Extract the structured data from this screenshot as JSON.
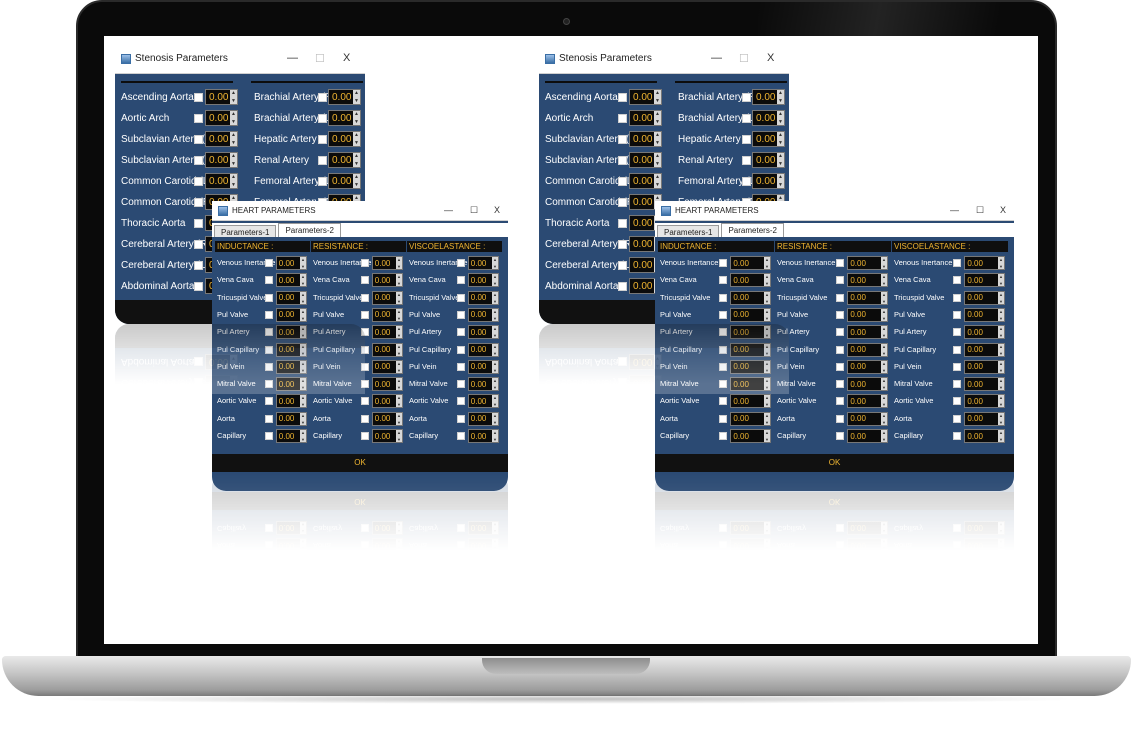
{
  "stenosis_window": {
    "title": "Stenosis Parameters",
    "minimize_glyph": "—",
    "maximize_glyph": "☐",
    "close_glyph": "X",
    "left_items": [
      {
        "label": "Ascending Aorta",
        "value": "0.00"
      },
      {
        "label": "Aortic Arch",
        "value": "0.00"
      },
      {
        "label": "Subclavian Artery (L)",
        "value": "0.00"
      },
      {
        "label": "Subclavian Artery (R)",
        "value": "0.00"
      },
      {
        "label": "Common Carotid (L)",
        "value": "0.00"
      },
      {
        "label": "Common Carotid (R)",
        "value": "0.00"
      },
      {
        "label": "Thoracic Aorta",
        "value": "0.00"
      },
      {
        "label": "Cereberal Artery (R)",
        "value": "0.00"
      },
      {
        "label": "Cereberal Artery (L)",
        "value": "0.00"
      },
      {
        "label": "Abdominal Aorta",
        "value": "0.00"
      }
    ],
    "right_items": [
      {
        "label": "Brachial Artery (R)",
        "value": "0.00"
      },
      {
        "label": "Brachial Artery (L)",
        "value": "0.00"
      },
      {
        "label": "Hepatic Artery",
        "value": "0.00"
      },
      {
        "label": "Renal Artery",
        "value": "0.00"
      },
      {
        "label": "Femoral Artery (L)",
        "value": "0.00"
      },
      {
        "label": "Femoral Artery (R)",
        "value": "0.00"
      }
    ]
  },
  "heart_window": {
    "title": "HEART PARAMETERS",
    "minimize_glyph": "—",
    "maximize_glyph": "☐",
    "close_glyph": "X",
    "tabs": [
      "Parameters-1",
      "Parameters-2"
    ],
    "active_tab": "Parameters-2",
    "columns": [
      "INDUCTANCE :",
      "RESISTANCE :",
      "VISCOELASTANCE :"
    ],
    "rows": [
      {
        "label": "Venous Inertance",
        "value": "0.00"
      },
      {
        "label": "Vena Cava",
        "value": "0.00"
      },
      {
        "label": "Tricuspid Valve",
        "value": "0.00"
      },
      {
        "label": "Pul Valve",
        "value": "0.00"
      },
      {
        "label": "Pul Artery",
        "value": "0.00"
      },
      {
        "label": "Pul Capillary",
        "value": "0.00"
      },
      {
        "label": "Pul Vein",
        "value": "0.00"
      },
      {
        "label": "Mitral Valve",
        "value": "0.00"
      },
      {
        "label": "Aortic Valve",
        "value": "0.00"
      },
      {
        "label": "Aorta",
        "value": "0.00"
      },
      {
        "label": "Capillary",
        "value": "0.00"
      }
    ],
    "ok_label": "OK"
  },
  "colors": {
    "panel": "#2b4a73",
    "value_text": "#f0b531",
    "input_bg": "#0b0b0b"
  },
  "icons": [
    "app-window-icon",
    "spin-up-icon",
    "spin-down-icon"
  ]
}
